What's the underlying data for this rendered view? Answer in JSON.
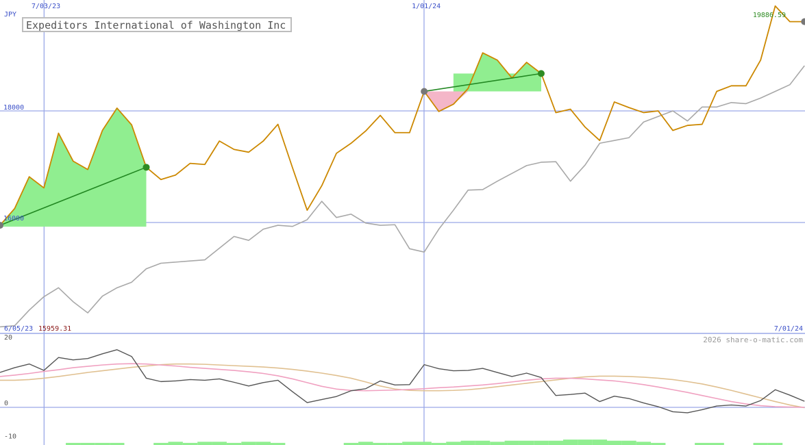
{
  "chart_data": {
    "type": "line",
    "title": "Expeditors International of Washington Inc",
    "currency": "JPY",
    "credit": "2026 share-o-matic.com",
    "colors": {
      "price": "#cc8800",
      "benchmark": "#a8a8a8",
      "trend_gain_fill": "#90ee90",
      "trend_loss_fill": "#f4b6c8",
      "trend_line": "#228822",
      "grid": "#9aa8e8",
      "osc_main": "#555555",
      "osc_pink": "#f0a0c0",
      "osc_tan": "#e0c090",
      "volume": "#90ee90",
      "axis_text": "#3a4fc8"
    },
    "upper": {
      "ylim": [
        14000,
        20000
      ],
      "yticks": [
        {
          "value": 16000,
          "label": "16000"
        },
        {
          "value": 18000,
          "label": "18000"
        }
      ],
      "x_top_labels": [
        {
          "index": 3,
          "label": "7/03/23"
        },
        {
          "index": 29,
          "label": "1/01/24"
        }
      ],
      "bottom_left_date": "6/05/23",
      "bottom_left_value": "15959.31",
      "bottom_right_date": "7/01/24",
      "last_value_label": "19886.59",
      "price": [
        15950,
        16250,
        16820,
        16620,
        17600,
        17100,
        16950,
        17650,
        18050,
        17750,
        16990,
        16770,
        16850,
        17060,
        17040,
        17460,
        17310,
        17260,
        17460,
        17760,
        16980,
        16220,
        16660,
        17240,
        17420,
        17640,
        17920,
        17610,
        17610,
        18350,
        17990,
        18120,
        18400,
        19040,
        18910,
        18590,
        18870,
        18670,
        17970,
        18030,
        17710,
        17470,
        18160,
        18060,
        17970,
        18000,
        17650,
        17740,
        17760,
        18350,
        18450,
        18450,
        18910,
        19880,
        19600,
        19600
      ],
      "benchmark": [
        14130,
        14150,
        14430,
        14670,
        14830,
        14580,
        14380,
        14680,
        14830,
        14930,
        15170,
        15270,
        15290,
        15310,
        15330,
        15540,
        15750,
        15680,
        15880,
        15950,
        15930,
        16050,
        16380,
        16090,
        16150,
        15990,
        15950,
        15960,
        15530,
        15470,
        15880,
        16220,
        16580,
        16590,
        16740,
        16880,
        17020,
        17080,
        17090,
        16740,
        17030,
        17420,
        17470,
        17520,
        17800,
        17900,
        18000,
        17820,
        18070,
        18070,
        18150,
        18130,
        18230,
        18350,
        18470,
        18810
      ],
      "trends": [
        {
          "from": 0,
          "to": 10,
          "start": 15950,
          "end": 16990,
          "kind": "gain"
        },
        {
          "from": 29,
          "to": 37,
          "start": 18350,
          "end": 18670,
          "kind": "mixed"
        }
      ]
    },
    "lower": {
      "ylim": [
        -10,
        20
      ],
      "yticks": [
        {
          "value": 20,
          "label": "20"
        },
        {
          "value": 0,
          "label": "0"
        },
        {
          "value": -10,
          "label": "-10"
        }
      ],
      "main": [
        10.3,
        11.7,
        12.8,
        10.9,
        14.7,
        14.0,
        14.4,
        15.8,
        17.0,
        15.0,
        8.6,
        7.6,
        7.8,
        8.2,
        8.0,
        8.4,
        7.4,
        6.3,
        7.3,
        8.0,
        4.6,
        1.4,
        2.3,
        3.2,
        4.9,
        5.5,
        7.8,
        6.6,
        6.7,
        12.6,
        11.4,
        10.8,
        10.9,
        11.5,
        10.3,
        9.1,
        10.1,
        8.8,
        3.5,
        3.8,
        4.2,
        1.7,
        3.3,
        2.6,
        1.3,
        0.2,
        -1.3,
        -1.6,
        -0.7,
        0.4,
        0.7,
        0.4,
        2.0,
        5.2,
        3.6,
        1.8
      ],
      "pink": [
        9.1,
        9.5,
        10.0,
        10.6,
        11.1,
        11.7,
        12.1,
        12.5,
        12.8,
        12.9,
        12.8,
        12.5,
        12.2,
        11.8,
        11.5,
        11.2,
        10.9,
        10.5,
        10.0,
        9.3,
        8.4,
        7.3,
        6.2,
        5.4,
        5.0,
        4.9,
        5.0,
        5.1,
        5.3,
        5.5,
        5.8,
        6.0,
        6.3,
        6.6,
        7.0,
        7.5,
        8.0,
        8.4,
        8.6,
        8.6,
        8.4,
        8.1,
        7.8,
        7.3,
        6.7,
        6.0,
        5.2,
        4.4,
        3.5,
        2.6,
        1.7,
        1.0,
        0.5,
        0.2,
        0.1,
        0.0
      ],
      "tan": [
        8.0,
        8.0,
        8.2,
        8.6,
        9.1,
        9.7,
        10.3,
        10.8,
        11.3,
        11.8,
        12.2,
        12.6,
        12.8,
        12.8,
        12.7,
        12.5,
        12.3,
        12.1,
        11.9,
        11.6,
        11.2,
        10.7,
        10.1,
        9.4,
        8.6,
        7.5,
        6.3,
        5.4,
        5.0,
        4.9,
        4.9,
        5.0,
        5.2,
        5.6,
        6.1,
        6.6,
        7.1,
        7.6,
        8.1,
        8.6,
        9.0,
        9.2,
        9.2,
        9.1,
        8.9,
        8.6,
        8.2,
        7.6,
        6.9,
        6.0,
        5.0,
        3.9,
        2.8,
        1.7,
        0.7,
        -0.1
      ],
      "volume_bars": [
        0,
        0,
        0,
        0,
        0,
        1,
        1,
        1,
        1,
        0,
        0,
        1,
        2,
        1,
        2,
        2,
        1,
        2,
        2,
        1,
        0,
        0,
        0,
        0,
        1,
        2,
        1,
        1,
        2,
        2,
        1,
        2,
        3,
        3,
        2,
        3,
        3,
        3,
        3,
        4,
        4,
        4,
        3,
        3,
        2,
        1,
        0,
        0,
        1,
        1,
        0,
        0,
        1,
        1,
        0,
        0
      ]
    }
  }
}
